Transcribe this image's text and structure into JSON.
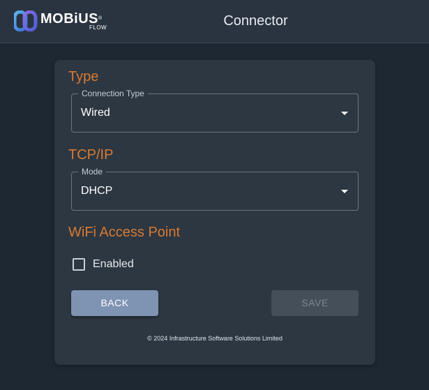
{
  "header": {
    "logo_text": "MOBiUS",
    "logo_reg": "®",
    "logo_sub": "FLOW",
    "title": "Connector"
  },
  "sections": {
    "type": {
      "heading": "Type",
      "field_label": "Connection Type",
      "value": "Wired"
    },
    "tcpip": {
      "heading": "TCP/IP",
      "field_label": "Mode",
      "value": "DHCP"
    },
    "wifi": {
      "heading": "WiFi Access Point",
      "checkbox_label": "Enabled",
      "checked": false
    }
  },
  "buttons": {
    "back_label": "BACK",
    "save_label": "SAVE",
    "save_disabled": true
  },
  "footer": {
    "copyright": "© 2024 Infrastructure Software Solutions Limited"
  },
  "colors": {
    "background": "#1e2833",
    "topbar": "#2a3440",
    "card": "#2d3741",
    "heading_accent": "#d77a34",
    "back_button": "#7f93b3",
    "save_button_disabled": "#454f5a"
  },
  "icons": {
    "logo": "mobius-logo-icon",
    "dropdown": "caret-down-icon",
    "checkbox": "checkbox-unchecked-icon"
  }
}
